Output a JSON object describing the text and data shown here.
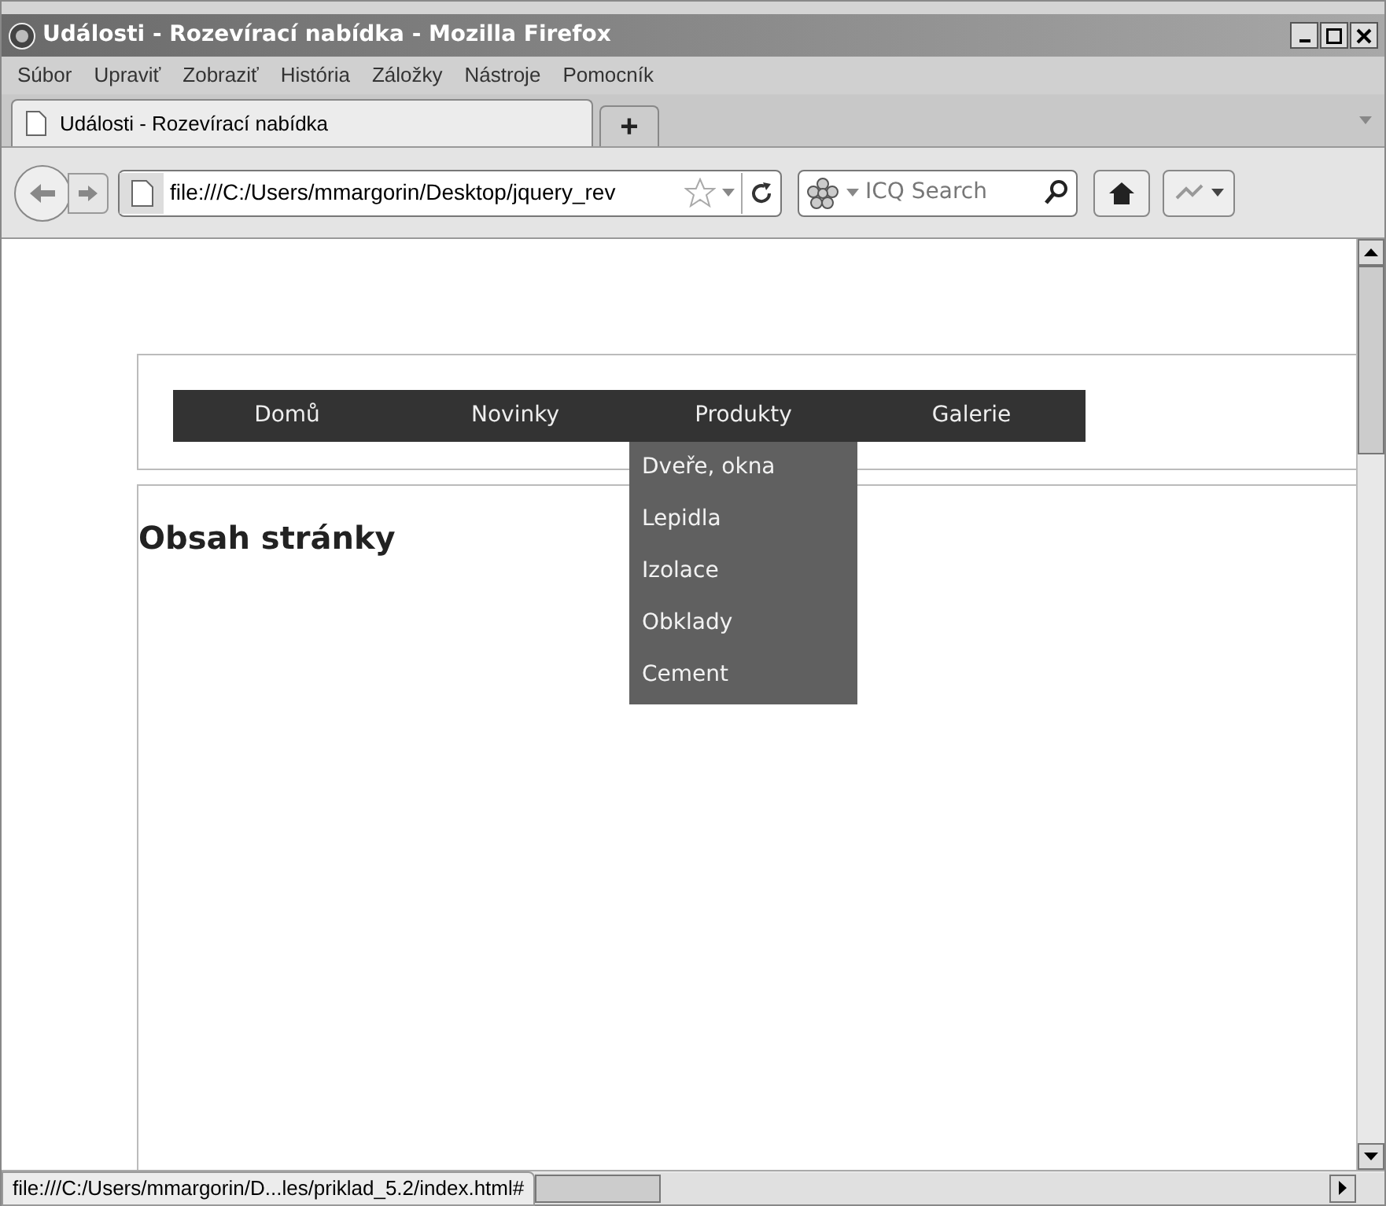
{
  "window": {
    "title": "Události - Rozevírací nabídka - Mozilla Firefox"
  },
  "menu": [
    "Súbor",
    "Upraviť",
    "Zobraziť",
    "História",
    "Záložky",
    "Nástroje",
    "Pomocník"
  ],
  "tabs": [
    {
      "label": "Události - Rozevírací nabídka",
      "selected": true
    }
  ],
  "new_tab": "+",
  "address": {
    "value": "file:///C:/Users/mmargorin/Desktop/jquery_rev"
  },
  "search": {
    "placeholder": "ICQ Search"
  },
  "nav": [
    {
      "label": "Domů"
    },
    {
      "label": "Novinky"
    },
    {
      "label": "Produkty",
      "children": [
        "Dveře, okna",
        "Lepidla",
        "Izolace",
        "Obklady",
        "Cement"
      ]
    },
    {
      "label": "Galerie"
    }
  ],
  "heading": "Obsah stránky",
  "status_bar": "file:///C:/Users/mmargorin/D...les/priklad_5.2/index.html#"
}
